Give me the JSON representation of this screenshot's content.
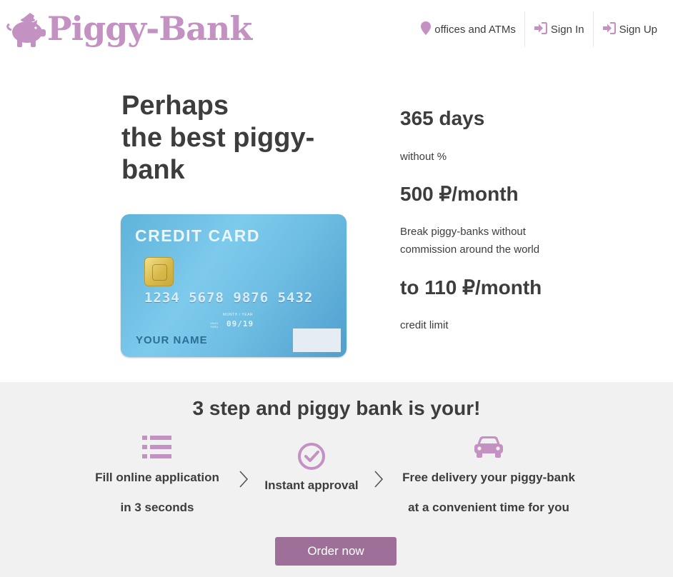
{
  "header": {
    "logo_text": "Piggy-Bank",
    "logo_icon": "piggy-icon",
    "nav": [
      {
        "label": "offices and ATMs",
        "icon": "map-pin-icon"
      },
      {
        "label": "Sign In",
        "icon": "sign-in-icon"
      },
      {
        "label": "Sign Up",
        "icon": "sign-in-icon"
      }
    ]
  },
  "hero": {
    "title_lines": [
      "Perhaps",
      "the best piggy-",
      "bank"
    ],
    "card": {
      "title": "CREDIT CARD",
      "number": "1234 5678 9876 5432",
      "valid_caption": "MONTH / YEAR",
      "valid_small": "VALID THRU",
      "valid": "09/19",
      "name": "YOUR NAME"
    },
    "features": [
      {
        "heading": "365 days",
        "description": "without %"
      },
      {
        "heading": "500 ₽/month",
        "description": "Break piggy-banks without commission around the world"
      },
      {
        "heading": "to 110 ₽/month",
        "description": "credit limit"
      }
    ]
  },
  "steps": {
    "title": "3 step and piggy bank is your!",
    "items": [
      {
        "line1": "Fill online application",
        "line2": "in 3 seconds",
        "icon": "list-icon"
      },
      {
        "line1": "Instant approval",
        "line2": "",
        "icon": "check-circle-icon"
      },
      {
        "line1": "Free delivery your piggy-bank",
        "line2": "at a convenient time for you",
        "icon": "car-icon"
      }
    ],
    "order_button": "Order now"
  },
  "colors": {
    "brand": "#c392c3",
    "button": "#9e7099",
    "section_bg": "#f1f1f1",
    "text": "#3d3d3d"
  }
}
